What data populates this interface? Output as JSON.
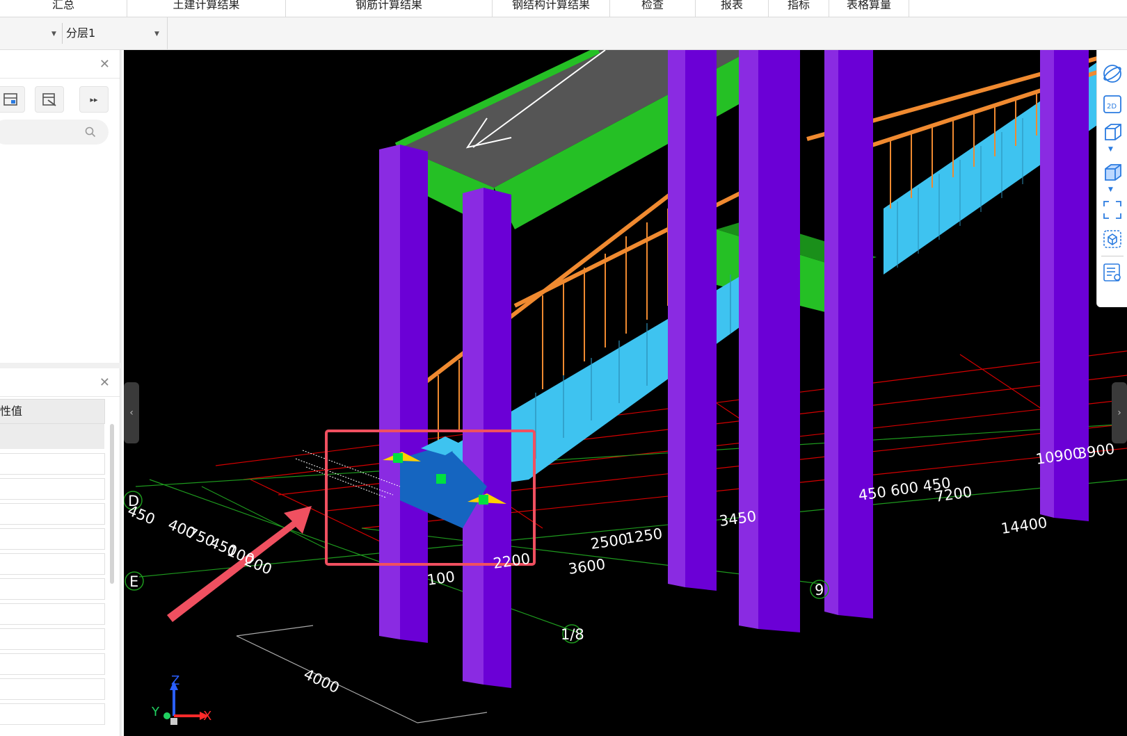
{
  "ribbon_tabs": [
    "汇总",
    "土建计算结果",
    "钢筋计算结果",
    "钢结构计算结果",
    "检查",
    "报表",
    "指标",
    "表格算量"
  ],
  "toolbar": {
    "floor_dropdown": "",
    "layer_dropdown": "分层1"
  },
  "property_panel": {
    "column_header": "性值"
  },
  "viewport": {
    "dimensions": [
      "450",
      "400",
      "750",
      "450",
      "100",
      "200",
      "2200",
      "100",
      "3600",
      "2500",
      "1250",
      "3450",
      "450 600 450",
      "7200",
      "10900",
      "3900",
      "14400",
      "4000"
    ],
    "axis_labels": [
      "D",
      "E",
      "9",
      "1/8"
    ],
    "triad": {
      "x": "X",
      "y": "Y",
      "z": "Z"
    },
    "colors": {
      "column": "#7f00ff",
      "beam": "#25c025",
      "stair": "#3ec3f0",
      "railing": "#f08a30",
      "grid_red": "#d60000",
      "grid_green": "#1e9a1e",
      "highlight": "#f05060"
    }
  },
  "view_tools": [
    "orbit-icon",
    "2d-view-icon",
    "3d-box-icon",
    "solid-box-icon",
    "fullscreen-icon",
    "component-view-icon",
    "property-view-icon"
  ]
}
